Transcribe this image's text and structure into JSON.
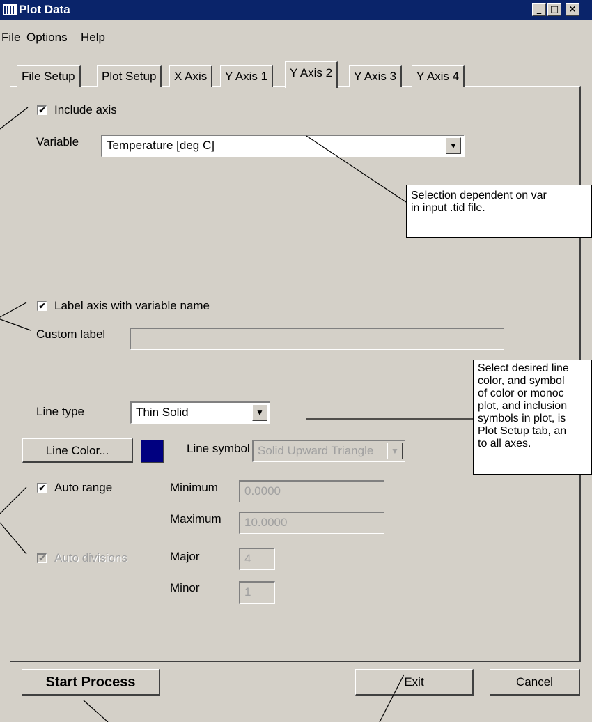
{
  "window": {
    "title": "Plot Data",
    "minimize": "_",
    "maximize": "□",
    "close": "×"
  },
  "menu": [
    "File",
    "Options",
    "Help"
  ],
  "tabs": [
    "File Setup",
    "Plot Setup",
    "X Axis",
    "Y Axis 1",
    "Y Axis 2",
    "Y Axis 3",
    "Y Axis 4"
  ],
  "active_tab": "Y Axis 2",
  "include_axis": {
    "label": "Include axis",
    "checked": true
  },
  "variable": {
    "label": "Variable",
    "value": "Temperature [deg C]"
  },
  "label_axis": {
    "label": "Label axis with variable name",
    "checked": true
  },
  "custom_label": {
    "label": "Custom label",
    "value": ""
  },
  "line_type": {
    "label": "Line type",
    "value": "Thin Solid"
  },
  "line_color": {
    "button": "Line Color...",
    "swatch": "#000080"
  },
  "line_symbol": {
    "label": "Line symbol",
    "value": "Solid Upward Triangle"
  },
  "auto_range": {
    "label": "Auto range",
    "checked": true
  },
  "minimum": {
    "label": "Minimum",
    "value": "0.0000"
  },
  "maximum": {
    "label": "Maximum",
    "value": "10.0000"
  },
  "auto_divisions": {
    "label": "Auto divisions",
    "checked": true
  },
  "major": {
    "label": "Major",
    "value": "4"
  },
  "minor": {
    "label": "Minor",
    "value": "1"
  },
  "buttons": {
    "start": "Start Process",
    "exit": "Exit",
    "cancel": "Cancel"
  },
  "notes": {
    "variable": "Selection dependent on var\nin input .tid file.",
    "line": "Select desired line\ncolor, and symbol\nof color or monoc\nplot, and inclusion\nsymbols in plot, is\nPlot Setup tab, an\nto all axes."
  },
  "icons": {
    "check": "✔",
    "dropdown": "▼"
  }
}
